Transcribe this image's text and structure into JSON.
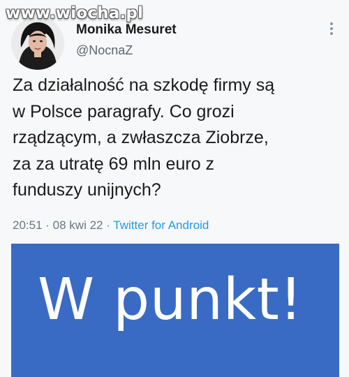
{
  "watermark": "www.wiocha.pl",
  "author": {
    "name": "Monika Mesuret",
    "handle": "@NocnaZ"
  },
  "tweet": {
    "text": "Za działalność na szkodę firmy są\nw Polsce paragrafy. Co grozi\nrządzącym, a zwłaszcza Ziobrze,\nza  za utratę 69 mln euro z\nfunduszy unijnych?",
    "time": "20:51",
    "date": "08 kwi 22",
    "source": "Twitter for Android",
    "separator": " · "
  },
  "image": {
    "text": "W punkt!",
    "background": "#3a6bc4"
  },
  "icons": {
    "more": "more-vertical-icon",
    "avatar": "avatar-photo"
  }
}
